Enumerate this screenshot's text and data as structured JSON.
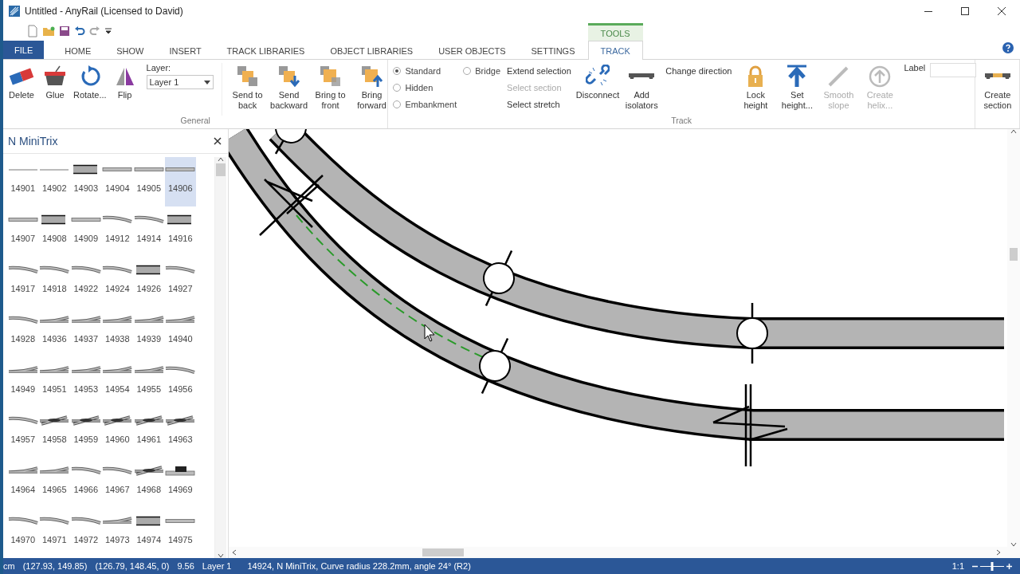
{
  "window": {
    "title": "Untitled - AnyRail (Licensed to David)"
  },
  "context_tab_group": "TOOLS",
  "tabs": [
    {
      "label": "FILE",
      "kind": "file",
      "selected": false
    },
    {
      "label": "HOME",
      "kind": "tab",
      "selected": false
    },
    {
      "label": "SHOW",
      "kind": "tab",
      "selected": false
    },
    {
      "label": "INSERT",
      "kind": "tab",
      "selected": false
    },
    {
      "label": "TRACK LIBRARIES",
      "kind": "tab",
      "selected": false
    },
    {
      "label": "OBJECT LIBRARIES",
      "kind": "tab",
      "selected": false
    },
    {
      "label": "USER OBJECTS",
      "kind": "tab",
      "selected": false
    },
    {
      "label": "SETTINGS",
      "kind": "tab",
      "selected": false
    },
    {
      "label": "TRACK",
      "kind": "context",
      "selected": true
    }
  ],
  "ribbon": {
    "groups": [
      {
        "label": "General",
        "items": [
          {
            "kind": "large",
            "label": "Delete",
            "disabled": false
          },
          {
            "kind": "large",
            "label": "Glue",
            "disabled": false
          },
          {
            "kind": "large",
            "label": "Rotate...",
            "disabled": false
          },
          {
            "kind": "large",
            "label": "Flip",
            "disabled": false
          },
          {
            "kind": "layer",
            "label": "Layer:",
            "value": "Layer 1"
          },
          {
            "kind": "large",
            "label": "Send to back",
            "disabled": false
          },
          {
            "kind": "large",
            "label": "Send backward",
            "disabled": false
          },
          {
            "kind": "large",
            "label": "Bring to front",
            "disabled": false
          },
          {
            "kind": "large",
            "label": "Bring forward",
            "disabled": false
          }
        ]
      },
      {
        "label": "Track",
        "items": [
          {
            "kind": "radios",
            "options": [
              {
                "label": "Standard",
                "selected": true
              },
              {
                "label": "Hidden",
                "selected": false
              },
              {
                "label": "Embankment",
                "selected": false
              }
            ]
          },
          {
            "kind": "radios",
            "options": [
              {
                "label": "Bridge",
                "selected": false
              }
            ]
          },
          {
            "kind": "smalls",
            "commands": [
              {
                "label": "Extend selection",
                "disabled": false
              },
              {
                "label": "Select section",
                "disabled": true
              },
              {
                "label": "Select stretch",
                "disabled": false
              }
            ]
          },
          {
            "kind": "large",
            "label": "Disconnect",
            "disabled": false
          },
          {
            "kind": "large",
            "label": "Add isolators",
            "disabled": false
          },
          {
            "kind": "smalls",
            "commands": [
              {
                "label": "Change direction",
                "disabled": false
              }
            ]
          },
          {
            "kind": "large",
            "label": "Lock height",
            "disabled": false
          },
          {
            "kind": "large",
            "label": "Set height...",
            "disabled": false
          },
          {
            "kind": "large",
            "label": "Smooth slope",
            "disabled": true
          },
          {
            "kind": "large",
            "label": "Create helix...",
            "disabled": true
          },
          {
            "kind": "labelfield",
            "label": "Label"
          }
        ]
      },
      {
        "items": [
          {
            "kind": "large",
            "label": "Create section",
            "disabled": false
          }
        ]
      }
    ]
  },
  "library_panel": {
    "title": "N MiniTrix",
    "items": [
      {
        "code": "14901",
        "kind": "thin",
        "selected": false
      },
      {
        "code": "14902",
        "kind": "thin",
        "selected": false
      },
      {
        "code": "14903",
        "kind": "wide",
        "selected": false
      },
      {
        "code": "14904",
        "kind": "plain",
        "selected": false
      },
      {
        "code": "14905",
        "kind": "plain",
        "selected": false
      },
      {
        "code": "14906",
        "kind": "plain",
        "selected": true
      },
      {
        "code": "14907",
        "kind": "plain",
        "selected": false
      },
      {
        "code": "14908",
        "kind": "wide",
        "selected": false
      },
      {
        "code": "14909",
        "kind": "plain",
        "selected": false
      },
      {
        "code": "14912",
        "kind": "curve",
        "selected": false
      },
      {
        "code": "14914",
        "kind": "curve",
        "selected": false
      },
      {
        "code": "14916",
        "kind": "wide",
        "selected": false
      },
      {
        "code": "14917",
        "kind": "curve",
        "selected": false
      },
      {
        "code": "14918",
        "kind": "curve",
        "selected": false
      },
      {
        "code": "14922",
        "kind": "curve",
        "selected": false
      },
      {
        "code": "14924",
        "kind": "curve",
        "selected": false
      },
      {
        "code": "14926",
        "kind": "wide",
        "selected": false
      },
      {
        "code": "14927",
        "kind": "curve",
        "selected": false
      },
      {
        "code": "14928",
        "kind": "curve",
        "selected": false
      },
      {
        "code": "14936",
        "kind": "switch",
        "selected": false
      },
      {
        "code": "14937",
        "kind": "switch",
        "selected": false
      },
      {
        "code": "14938",
        "kind": "switch",
        "selected": false
      },
      {
        "code": "14939",
        "kind": "switch",
        "selected": false
      },
      {
        "code": "14940",
        "kind": "switch",
        "selected": false
      },
      {
        "code": "14949",
        "kind": "switch",
        "selected": false
      },
      {
        "code": "14951",
        "kind": "switch",
        "selected": false
      },
      {
        "code": "14953",
        "kind": "switch",
        "selected": false
      },
      {
        "code": "14954",
        "kind": "switch",
        "selected": false
      },
      {
        "code": "14955",
        "kind": "switch",
        "selected": false
      },
      {
        "code": "14956",
        "kind": "curve",
        "selected": false
      },
      {
        "code": "14957",
        "kind": "curve",
        "selected": false
      },
      {
        "code": "14958",
        "kind": "crossing",
        "selected": false
      },
      {
        "code": "14959",
        "kind": "crossing",
        "selected": false
      },
      {
        "code": "14960",
        "kind": "crossing",
        "selected": false
      },
      {
        "code": "14961",
        "kind": "crossing",
        "selected": false
      },
      {
        "code": "14963",
        "kind": "crossing",
        "selected": false
      },
      {
        "code": "14964",
        "kind": "switch",
        "selected": false
      },
      {
        "code": "14965",
        "kind": "switch",
        "selected": false
      },
      {
        "code": "14966",
        "kind": "curve",
        "selected": false
      },
      {
        "code": "14967",
        "kind": "curve",
        "selected": false
      },
      {
        "code": "14968",
        "kind": "crossing",
        "selected": false
      },
      {
        "code": "14969",
        "kind": "bumper",
        "selected": false
      },
      {
        "code": "14970",
        "kind": "curve",
        "selected": false
      },
      {
        "code": "14971",
        "kind": "curve",
        "selected": false
      },
      {
        "code": "14972",
        "kind": "curve",
        "selected": false
      },
      {
        "code": "14973",
        "kind": "switch",
        "selected": false
      },
      {
        "code": "14974",
        "kind": "wide",
        "selected": false
      },
      {
        "code": "14975",
        "kind": "plain",
        "selected": false
      }
    ]
  },
  "status_bar": {
    "unit": "cm",
    "fields": [
      "(127.93, 149.85)",
      "(126.79, 148.45, 0)",
      "9.56",
      "Layer 1",
      "14924, N MiniTrix, Curve radius 228.2mm, angle 24° (R2)"
    ],
    "zoom": "1:1",
    "zoom_slider": {
      "level": 0.5
    }
  }
}
